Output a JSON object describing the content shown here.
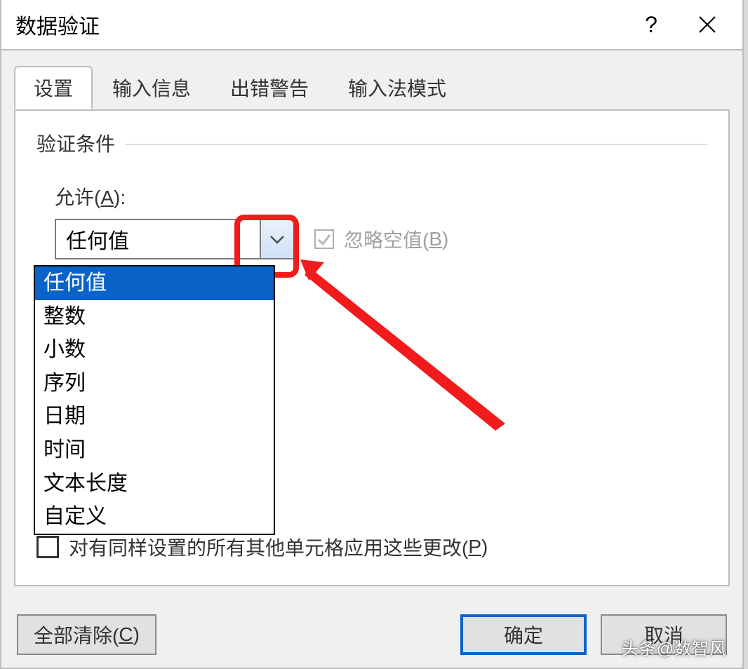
{
  "titlebar": {
    "title": "数据验证"
  },
  "tabs": [
    {
      "label": "设置",
      "active": true
    },
    {
      "label": "输入信息",
      "active": false
    },
    {
      "label": "出错警告",
      "active": false
    },
    {
      "label": "输入法模式",
      "active": false
    }
  ],
  "fieldset_label": "验证条件",
  "allow": {
    "label_prefix": "允许(",
    "label_hotkey": "A",
    "label_suffix": "):",
    "selected": "任何值",
    "options": [
      "任何值",
      "整数",
      "小数",
      "序列",
      "日期",
      "时间",
      "文本长度",
      "自定义"
    ]
  },
  "ignore_blank": {
    "checked": true,
    "label_prefix": "忽略空值(",
    "label_hotkey": "B",
    "label_suffix": ")"
  },
  "apply_all": {
    "checked": false,
    "label_prefix": "对有同样设置的所有其他单元格应用这些更改(",
    "label_hotkey": "P",
    "label_suffix": ")"
  },
  "buttons": {
    "clear_prefix": "全部清除(",
    "clear_hotkey": "C",
    "clear_suffix": ")",
    "ok": "确定",
    "cancel": "取消"
  },
  "watermark": "头条@数智风"
}
